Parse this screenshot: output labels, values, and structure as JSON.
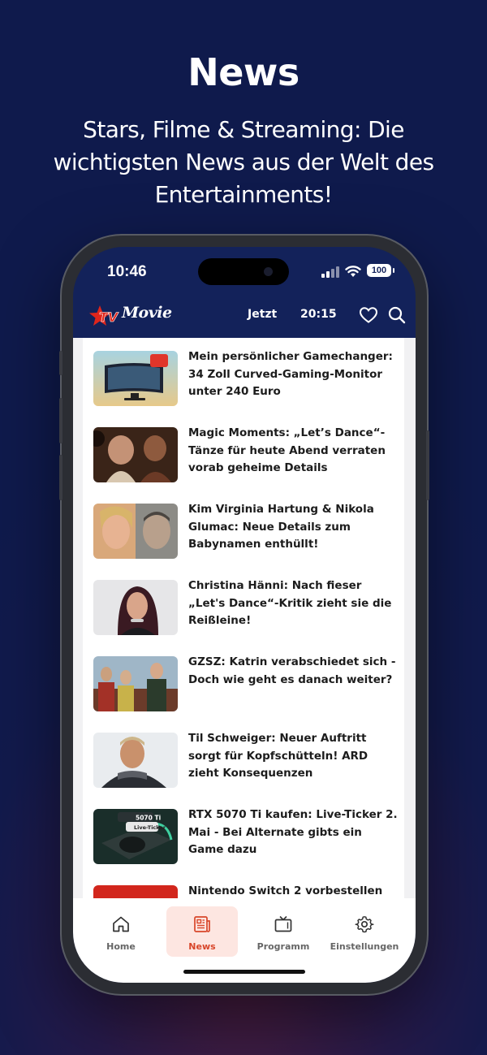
{
  "promo": {
    "title": "News",
    "subtitle": "Stars, Filme & Streaming: Die wichtigsten News aus der Welt des Entertainments!"
  },
  "statusbar": {
    "time": "10:46",
    "battery": "100"
  },
  "appbar": {
    "logo_text": "Movie",
    "nav": [
      "Jetzt",
      "20:15"
    ],
    "icons": [
      "heart-icon",
      "search-icon"
    ]
  },
  "articles": [
    {
      "headline": "Mein persönlicher Gamechanger: 34 Zoll Curved-Gaming-Monitor unter 240 Euro",
      "thumb": "monitor"
    },
    {
      "headline": "Magic Moments: „Let’s Dance“-Tänze für heute Abend verraten vorab geheime Details",
      "thumb": "dance"
    },
    {
      "headline": "Kim Virginia Hartung & Nikola Glumac: Neue Details zum Babynamen enthüllt!",
      "thumb": "couple"
    },
    {
      "headline": "Christina Hänni: Nach fieser „Let's Dance“-Kritik zieht sie die Reißleine!",
      "thumb": "portrait"
    },
    {
      "headline": "GZSZ: Katrin verabschiedet sich - Doch wie geht es danach weiter?",
      "thumb": "scene"
    },
    {
      "headline": "Til Schweiger: Neuer Auftritt sorgt für Kopfschütteln! ARD zieht Konsequenzen",
      "thumb": "man"
    },
    {
      "headline": "RTX 5070 Ti kaufen: Live-Ticker 2. Mai - Bei Alternate gibts ein Game dazu",
      "thumb": "gpu",
      "thumb_label_1": "5070 Ti",
      "thumb_label_2": "Live-Ticker"
    },
    {
      "headline": "Nintendo Switch 2 vorbestellen",
      "thumb": "switch"
    }
  ],
  "tabbar": {
    "tabs": [
      {
        "label": "Home",
        "icon": "home-icon"
      },
      {
        "label": "News",
        "icon": "news-icon",
        "active": true
      },
      {
        "label": "Programm",
        "icon": "tv-icon"
      },
      {
        "label": "Einstellungen",
        "icon": "gear-icon"
      }
    ]
  },
  "colors": {
    "background": "#0f1a4c",
    "app_header": "#13225a",
    "accent": "#d8462a",
    "active_tab_bg": "#fde6e1"
  }
}
